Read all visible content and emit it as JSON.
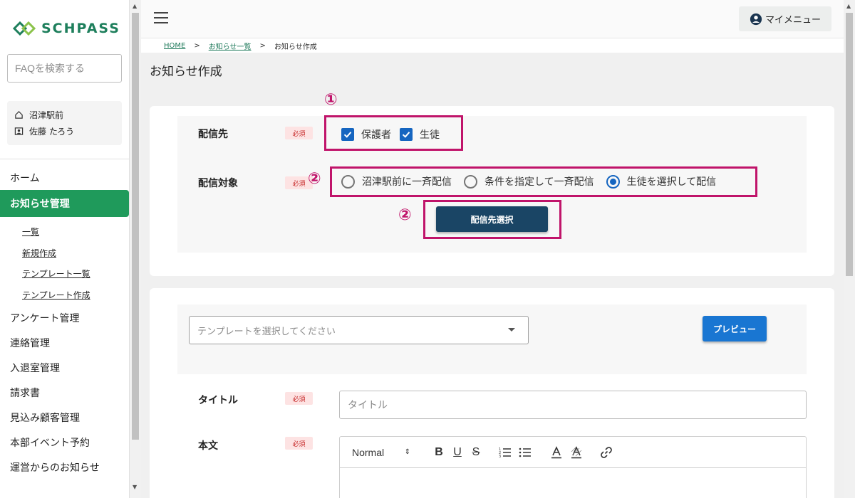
{
  "app": {
    "logo_text": "SCHPASS"
  },
  "sidebar": {
    "faq_placeholder": "FAQを検索する",
    "school": "沼津駅前",
    "user": "佐藤 たろう",
    "items": [
      {
        "label": "ホーム"
      },
      {
        "label": "お知らせ管理"
      },
      {
        "label": "アンケート管理"
      },
      {
        "label": "連絡管理"
      },
      {
        "label": "入退室管理"
      },
      {
        "label": "請求書"
      },
      {
        "label": "見込み顧客管理"
      },
      {
        "label": "本部イベント予約"
      },
      {
        "label": "運営からのお知らせ"
      }
    ],
    "sub_items": [
      {
        "label": "一覧"
      },
      {
        "label": "新規作成"
      },
      {
        "label": "テンプレート一覧"
      },
      {
        "label": "テンプレート作成"
      }
    ]
  },
  "header": {
    "my_menu": "マイメニュー"
  },
  "breadcrumb": {
    "home": "HOME",
    "sep": ">",
    "list": "お知らせ一覧",
    "current": "お知らせ作成"
  },
  "page_title": "お知らせ作成",
  "form": {
    "recipient_label": "配信先",
    "required_badge": "必須",
    "recipients": [
      {
        "label": "保護者",
        "checked": true
      },
      {
        "label": "生徒",
        "checked": true
      }
    ],
    "target_label": "配信対象",
    "targets": [
      {
        "label": "沼津駅前に一斉配信",
        "selected": false
      },
      {
        "label": "条件を指定して一斉配信",
        "selected": false
      },
      {
        "label": "生徒を選択して配信",
        "selected": true
      }
    ],
    "select_button": "配信先選択",
    "template_placeholder": "テンプレートを選択してください",
    "preview_button": "プレビュー",
    "title_label": "タイトル",
    "title_placeholder": "タイトル",
    "body_label": "本文",
    "editor": {
      "format": "Normal",
      "bold": "B",
      "underline": "U",
      "strike": "S"
    }
  },
  "annotations": {
    "marker1": "①",
    "marker2": "②"
  },
  "colors": {
    "brand_green": "#1f9a5b",
    "highlight": "#c0146a",
    "primary_dark": "#1a4565",
    "primary_blue": "#1976d2"
  }
}
